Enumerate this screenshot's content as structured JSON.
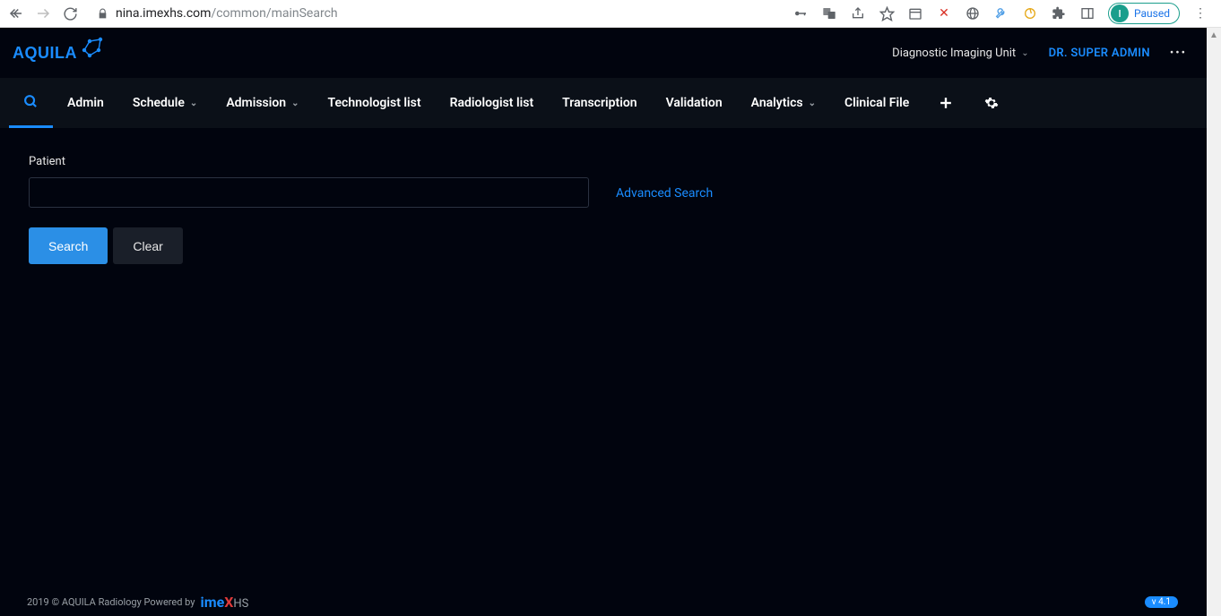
{
  "browser": {
    "url_host": "nina.imexhs.com",
    "url_path": "/common/mainSearch",
    "paused_label": "Paused",
    "avatar_initial": "I"
  },
  "header": {
    "logo_text": "AQUILA",
    "unit_label": "Diagnostic Imaging Unit",
    "user_label": "DR. SUPER ADMIN"
  },
  "nav": {
    "items": [
      {
        "label": "Admin",
        "dropdown": false
      },
      {
        "label": "Schedule",
        "dropdown": true
      },
      {
        "label": "Admission",
        "dropdown": true
      },
      {
        "label": "Technologist list",
        "dropdown": false
      },
      {
        "label": "Radiologist list",
        "dropdown": false
      },
      {
        "label": "Transcription",
        "dropdown": false
      },
      {
        "label": "Validation",
        "dropdown": false
      },
      {
        "label": "Analytics",
        "dropdown": true
      },
      {
        "label": "Clinical File",
        "dropdown": false
      }
    ]
  },
  "content": {
    "patient_label": "Patient",
    "search_btn": "Search",
    "clear_btn": "Clear",
    "advanced_link": "Advanced Search"
  },
  "footer": {
    "copyright": "2019 © AQUILA Radiology Powered by",
    "brand_a": "ime",
    "brand_x": "X",
    "brand_hs": "HS",
    "version": "v 4.1"
  }
}
